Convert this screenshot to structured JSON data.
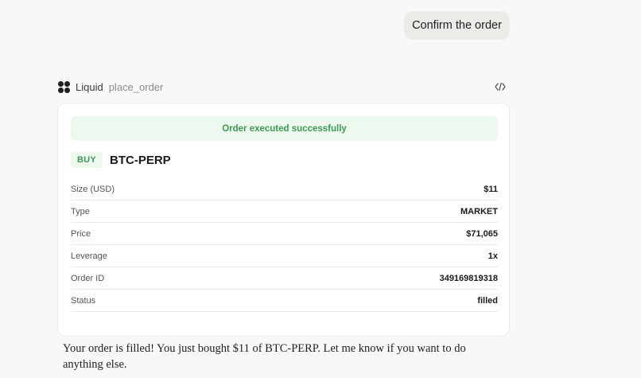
{
  "user_message": "Confirm the order",
  "tool": {
    "name": "Liquid",
    "function": "place_order",
    "logo_icon": "four-dot-logo-icon",
    "code_icon": "code-brackets-icon"
  },
  "order_card": {
    "status_banner": "Order executed successfully",
    "side": "BUY",
    "symbol": "BTC-PERP",
    "rows": [
      {
        "label": "Size (USD)",
        "value": "$11"
      },
      {
        "label": "Type",
        "value": "MARKET"
      },
      {
        "label": "Price",
        "value": "$71,065"
      },
      {
        "label": "Leverage",
        "value": "1x"
      },
      {
        "label": "Order ID",
        "value": "349169819318"
      },
      {
        "label": "Status",
        "value": "filled"
      }
    ]
  },
  "assistant_message": "Your order is filled! You just bought $11 of BTC-PERP. Let me know if you want to do anything else.",
  "colors": {
    "success_green": "#3d9a52",
    "success_bg": "#edf8ef",
    "page_bg": "#f8f8f6",
    "user_bubble_bg": "#ecebe7"
  }
}
